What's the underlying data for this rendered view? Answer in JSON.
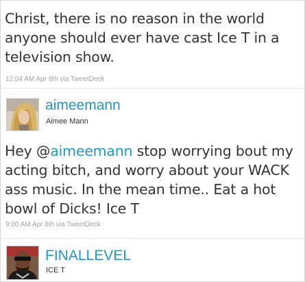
{
  "colors": {
    "link": "#1f98c7",
    "text": "#333333",
    "meta": "#a3a3a3"
  },
  "tweet1": {
    "text": "Christ, there is no reason in the world anyone should ever have cast Ice T in a television show.",
    "meta": "12:04 AM Apr 8th via TweetDeck"
  },
  "user1": {
    "screen_name": "aimeemann",
    "real_name": "Aimee Mann",
    "avatar_icon": "blonde-woman-avatar"
  },
  "tweet2": {
    "text_before": "Hey @",
    "mention": "aimeemann",
    "text_after": " stop worrying bout my acting bitch, and worry about your WACK ass music. In the mean time.. Eat a hot bowl of Dicks! Ice T",
    "meta": "9:00 AM Apr 8th via TweetDeck"
  },
  "user2": {
    "screen_name": "FINALLEVEL",
    "real_name": "ICE T",
    "avatar_icon": "man-with-sunglasses-avatar"
  }
}
